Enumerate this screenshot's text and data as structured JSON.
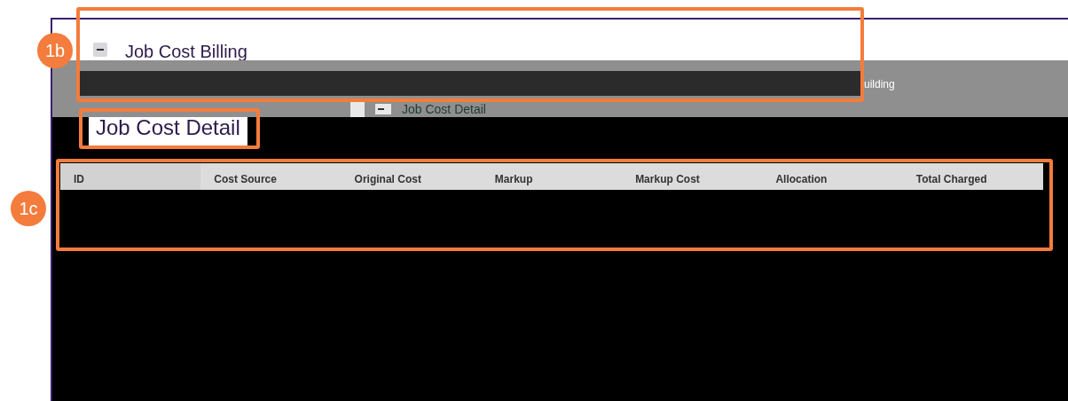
{
  "annotations": [
    {
      "label": "1b"
    },
    {
      "label": "1c"
    }
  ],
  "section": {
    "title": "Job Cost Billing",
    "expanded": true
  },
  "fragment": "uilding",
  "subsection": {
    "title": "Job Cost Detail",
    "expanded": true
  },
  "page_title": "Job Cost Detail",
  "table": {
    "columns": [
      "ID",
      "Cost Source",
      "Original Cost",
      "Markup",
      "Markup Cost",
      "Allocation",
      "Total Charged"
    ]
  }
}
